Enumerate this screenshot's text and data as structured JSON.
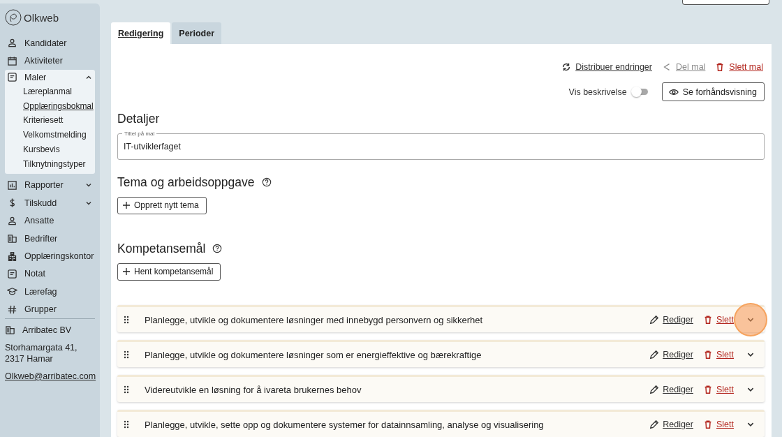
{
  "sidebar": {
    "logo": "Olkweb",
    "items": [
      {
        "label": "Kandidater",
        "kind": "link"
      },
      {
        "label": "Aktiviteter",
        "kind": "link"
      },
      {
        "label": "Maler",
        "kind": "group",
        "expanded": true,
        "children": [
          {
            "label": "Læreplanmal",
            "selected": false
          },
          {
            "label": "Opplæringsbokmal",
            "selected": true
          },
          {
            "label": "Kriteriesett",
            "selected": false
          },
          {
            "label": "Velkomstmelding",
            "selected": false
          },
          {
            "label": "Kursbevis",
            "selected": false
          },
          {
            "label": "Tilknytningstyper",
            "selected": false
          }
        ]
      },
      {
        "label": "Rapporter",
        "kind": "group",
        "expanded": false
      },
      {
        "label": "Tilskudd",
        "kind": "group",
        "expanded": false
      },
      {
        "label": "Ansatte",
        "kind": "link"
      },
      {
        "label": "Bedrifter",
        "kind": "link"
      },
      {
        "label": "Opplæringskontor",
        "kind": "link"
      },
      {
        "label": "Notat",
        "kind": "link"
      },
      {
        "label": "Lærefag",
        "kind": "link"
      },
      {
        "label": "Grupper",
        "kind": "link"
      }
    ],
    "footer": {
      "company": "Arribatec BV",
      "address": "Storhamargata 41, 2317 Hamar",
      "email": "Olkweb@arribatec.com"
    }
  },
  "tabs": [
    {
      "label": "Redigering",
      "selected": true
    },
    {
      "label": "Perioder",
      "selected": false
    }
  ],
  "actions": [
    {
      "label": "Distribuer endringer",
      "kind": "sync"
    },
    {
      "label": "Del mal",
      "kind": "share"
    },
    {
      "label": "Slett mal",
      "kind": "delete"
    }
  ],
  "toggle": {
    "label": "Vis beskrivelse",
    "on": false
  },
  "preview_button": "Se forhåndsvisning",
  "details": {
    "heading": "Detaljer",
    "field_label": "Tittel på mal",
    "value": "IT-utviklerfaget"
  },
  "themes": {
    "heading": "Tema og arbeidsoppgave",
    "button": "Opprett nytt tema"
  },
  "goals": {
    "heading": "Kompetansemål",
    "button": "Hent kompetansemål",
    "items": [
      {
        "title": "Planlegge, utvikle og dokumentere løsninger med innebygd personvern og sikkerhet",
        "edit": "Rediger",
        "delete": "Slett"
      },
      {
        "title": "Planlegge, utvikle og dokumentere løsninger som er energieffektive og bærekraftige",
        "edit": "Rediger",
        "delete": "Slett"
      },
      {
        "title": "Videreutvikle en løsning for å ivareta brukernes behov",
        "edit": "Rediger",
        "delete": "Slett"
      },
      {
        "title": "Planlegge, utvikle, sette opp og dokumentere systemer for datainnsamling, analyse og visualisering",
        "edit": "Rediger",
        "delete": "Slett"
      }
    ]
  }
}
